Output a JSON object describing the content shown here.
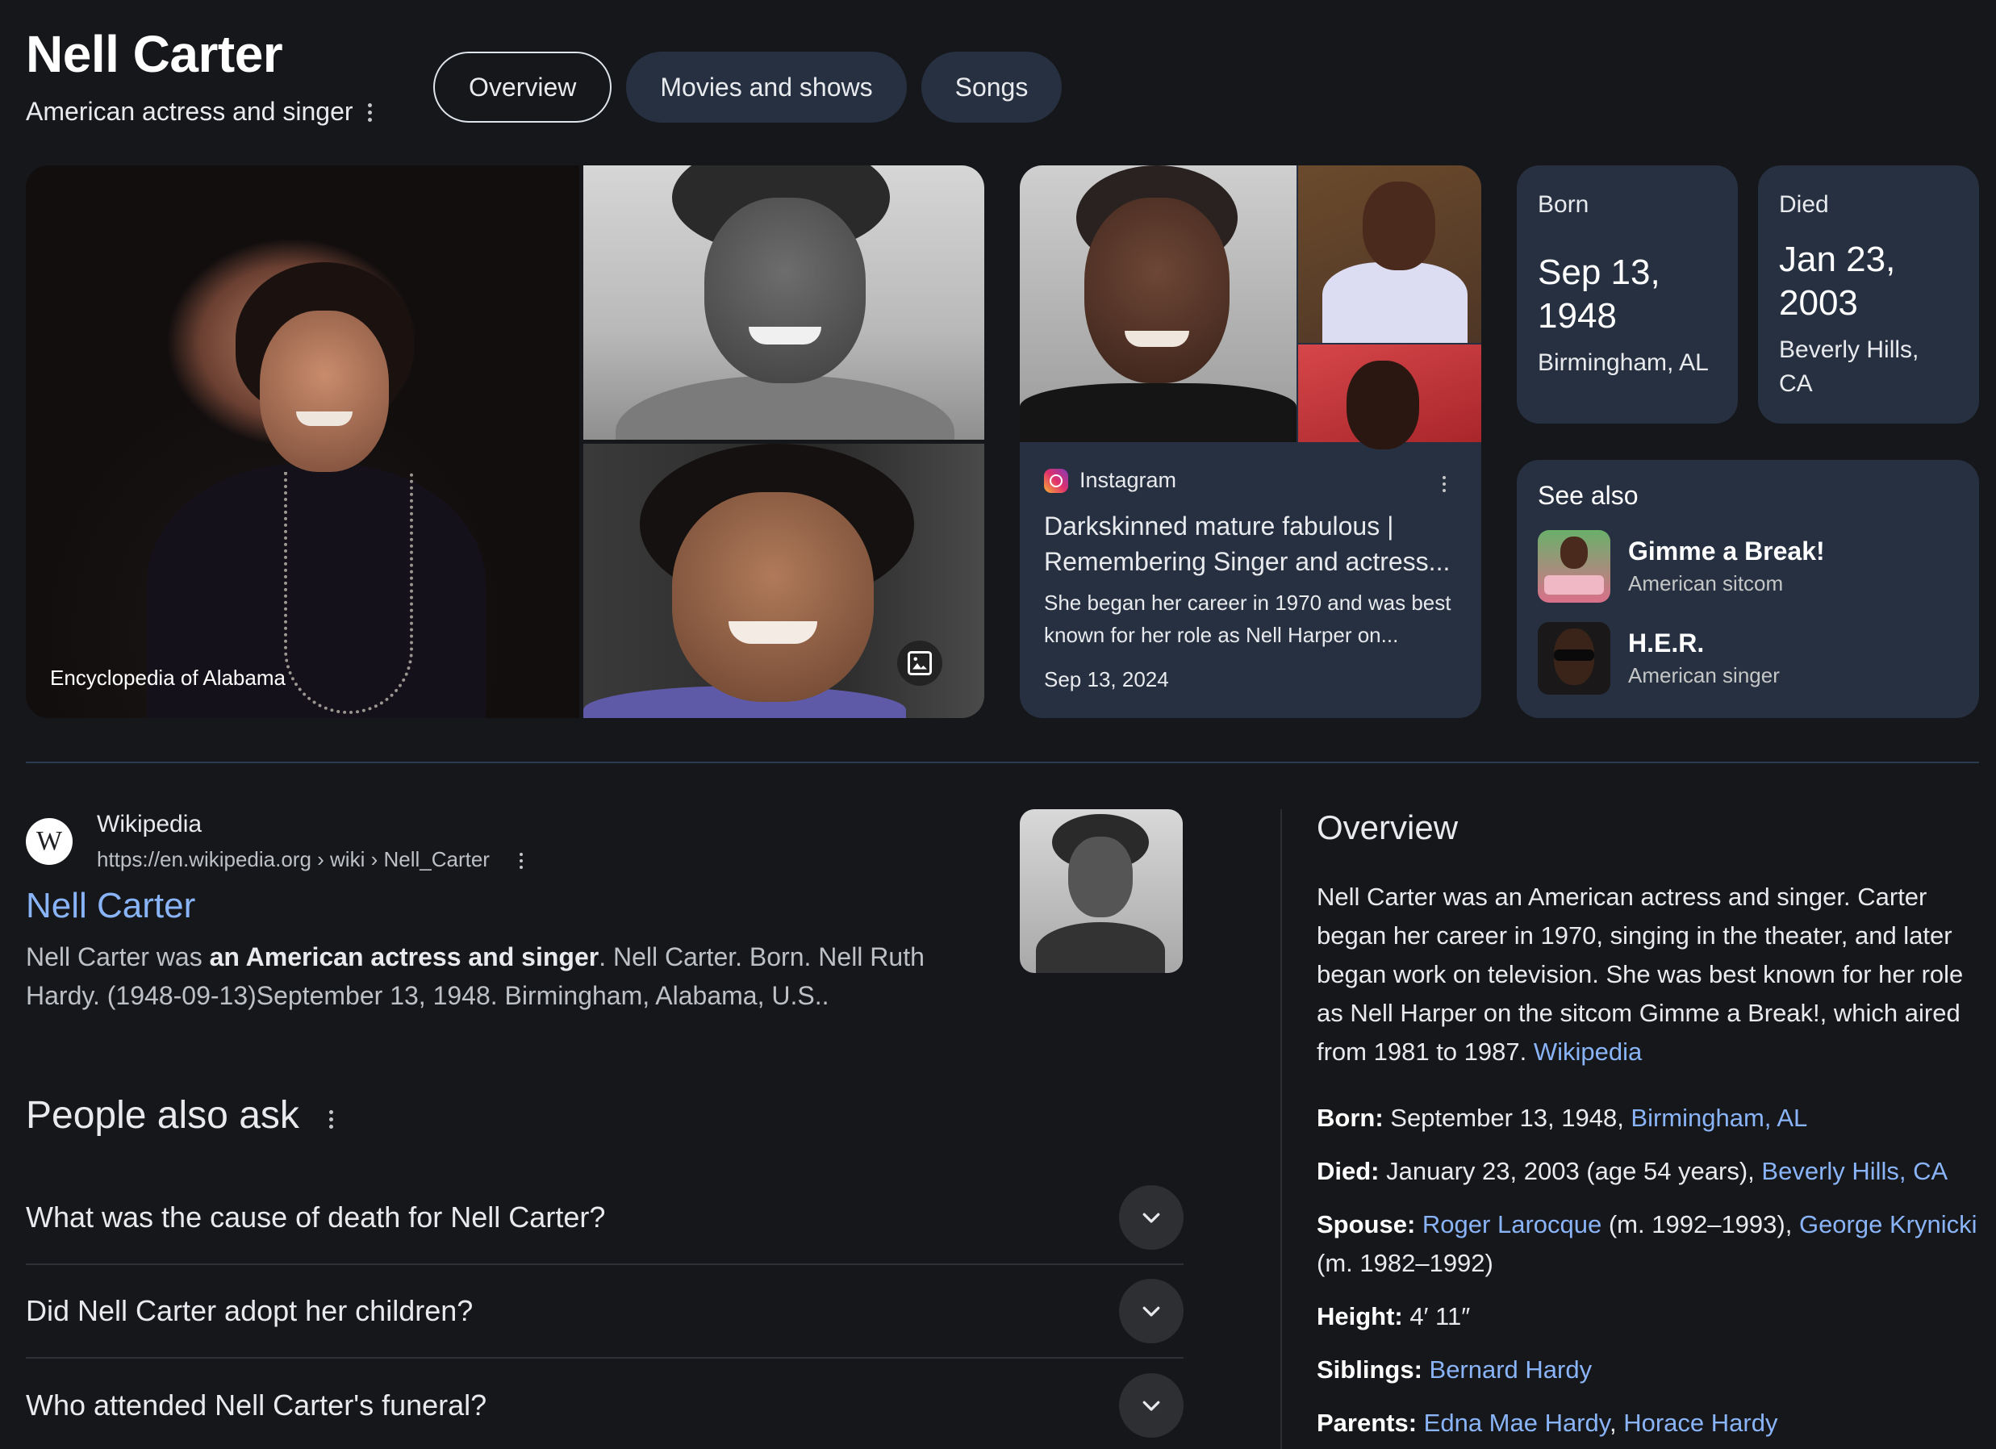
{
  "header": {
    "title": "Nell Carter",
    "subtitle": "American actress and singer"
  },
  "tabs": [
    "Overview",
    "Movies and shows",
    "Songs"
  ],
  "images": {
    "main_caption": "Encyclopedia of Alabama"
  },
  "instagram_card": {
    "source": "Instagram",
    "title": "Darkskinned mature fabulous | Remembering Singer and actress...",
    "description": "She began her career in 1970 and was best known for her role as Nell Harper on...",
    "date": "Sep 13, 2024"
  },
  "born": {
    "label": "Born",
    "date": "Sep 13, 1948",
    "place": "Birmingham, AL"
  },
  "died": {
    "label": "Died",
    "date": "Jan 23, 2003",
    "place": "Beverly Hills, CA"
  },
  "see_also": {
    "title": "See also",
    "items": [
      {
        "name": "Gimme a Break!",
        "subtitle": "American sitcom"
      },
      {
        "name": "H.E.R.",
        "subtitle": "American singer"
      }
    ]
  },
  "wiki_result": {
    "logo": "W",
    "site": "Wikipedia",
    "url": "https://en.wikipedia.org › wiki › Nell_Carter",
    "title": "Nell Carter",
    "snippet_pre": "Nell Carter was ",
    "snippet_bold": "an American actress and singer",
    "snippet_post": ". Nell Carter. Born. Nell Ruth Hardy. (1948-09-13)September 13, 1948. Birmingham, Alabama, U.S.."
  },
  "people_also_ask": {
    "title": "People also ask",
    "questions": [
      "What was the cause of death for Nell Carter?",
      "Did Nell Carter adopt her children?",
      "Who attended Nell Carter's funeral?"
    ]
  },
  "overview_panel": {
    "title": "Overview",
    "description": "Nell Carter was an American actress and singer. Carter began her career in 1970, singing in the theater, and later began work on television. She was best known for her role as Nell Harper on the sitcom Gimme a Break!, which aired from 1981 to 1987. ",
    "source_link": "Wikipedia",
    "facts": {
      "born_label": "Born:",
      "born_text": " September 13, 1948, ",
      "born_link": "Birmingham, AL",
      "died_label": "Died:",
      "died_text": " January 23, 2003 (age 54 years), ",
      "died_link": "Beverly Hills, CA",
      "spouse_label": "Spouse:",
      "spouse_link1": "Roger Larocque",
      "spouse_text1": " (m. 1992–1993), ",
      "spouse_link2": "George Krynicki",
      "spouse_text2": " (m. 1982–1992)",
      "height_label": "Height:",
      "height_text": " 4′ 11″",
      "siblings_label": "Siblings:",
      "siblings_link": "Bernard Hardy",
      "parents_label": "Parents:",
      "parents_link1": "Edna Mae Hardy",
      "parents_sep": ", ",
      "parents_link2": "Horace Hardy"
    }
  },
  "colors": {
    "background": "#16171b",
    "card": "#263041",
    "link": "#8ab4f8",
    "text": "#e8eaed"
  },
  "icons": [
    "more-vert-icon",
    "image-search-icon",
    "instagram-icon",
    "wikipedia-icon",
    "chevron-down-icon"
  ]
}
